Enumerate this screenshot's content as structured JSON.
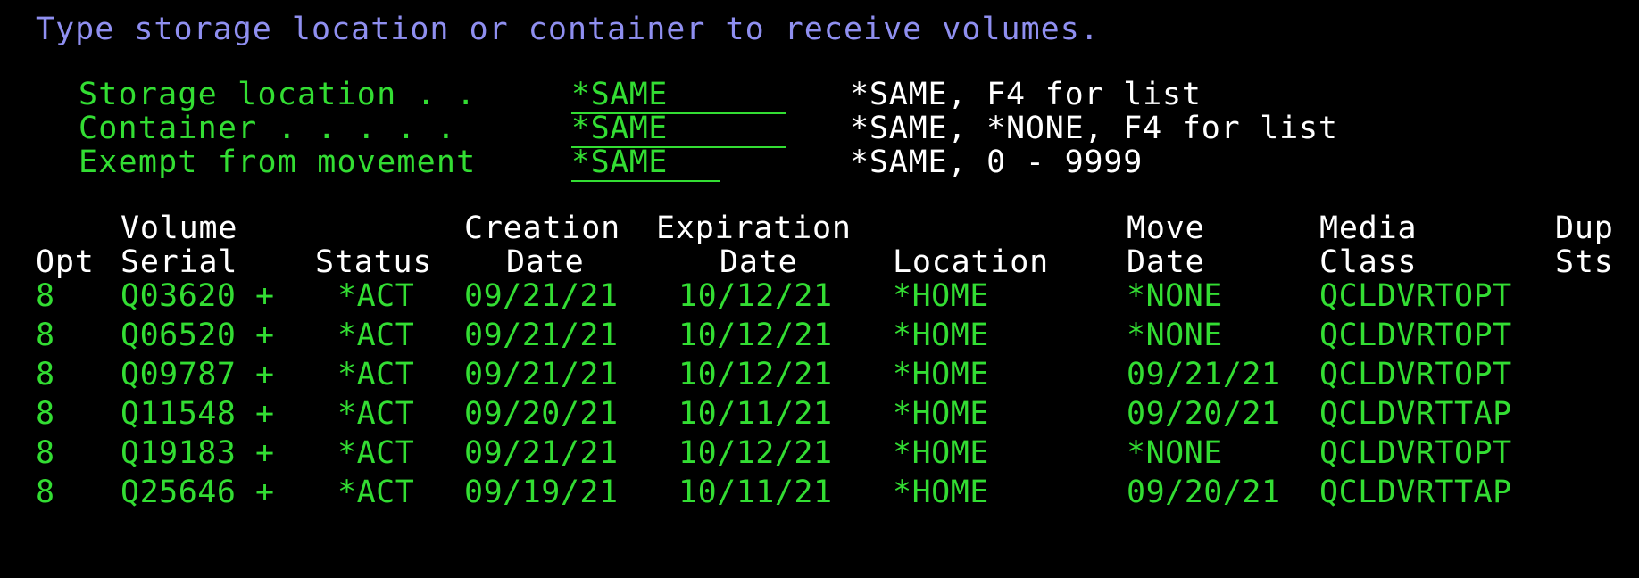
{
  "instruction": "Type storage location or container to receive volumes.",
  "fields": [
    {
      "label": "Storage location . .",
      "value": "*SAME",
      "hint": "*SAME, F4 for list"
    },
    {
      "label": "Container . . . . .",
      "value": "*SAME",
      "hint": "*SAME, *NONE, F4 for list"
    },
    {
      "label": "Exempt from movement",
      "value": "*SAME",
      "hint": "*SAME, 0 - 9999"
    }
  ],
  "table": {
    "header_line1": {
      "volume": "Volume",
      "creation": "Creation",
      "expiration": "Expiration",
      "move": "Move",
      "media": "Media",
      "dup": "Dup"
    },
    "header_line2": {
      "opt": "Opt",
      "serial": "Serial",
      "status": "Status",
      "creation": "Date",
      "expiration": "Date",
      "location": "Location",
      "move": "Date",
      "media": "Class",
      "dup": "Sts"
    },
    "rows": [
      {
        "opt": "8",
        "serial": "Q03620 +",
        "status": "*ACT",
        "creation": "09/21/21",
        "expiration": "10/12/21",
        "location": "*HOME",
        "move": "*NONE",
        "media": "QCLDVRTOPT"
      },
      {
        "opt": "8",
        "serial": "Q06520 +",
        "status": "*ACT",
        "creation": "09/21/21",
        "expiration": "10/12/21",
        "location": "*HOME",
        "move": "*NONE",
        "media": "QCLDVRTOPT"
      },
      {
        "opt": "8",
        "serial": "Q09787 +",
        "status": "*ACT",
        "creation": "09/21/21",
        "expiration": "10/12/21",
        "location": "*HOME",
        "move": "09/21/21",
        "media": "QCLDVRTOPT"
      },
      {
        "opt": "8",
        "serial": "Q11548 +",
        "status": "*ACT",
        "creation": "09/20/21",
        "expiration": "10/11/21",
        "location": "*HOME",
        "move": "09/20/21",
        "media": "QCLDVRTTAP"
      },
      {
        "opt": "8",
        "serial": "Q19183 +",
        "status": "*ACT",
        "creation": "09/21/21",
        "expiration": "10/12/21",
        "location": "*HOME",
        "move": "*NONE",
        "media": "QCLDVRTOPT"
      },
      {
        "opt": "8",
        "serial": "Q25646 +",
        "status": "*ACT",
        "creation": "09/19/21",
        "expiration": "10/11/21",
        "location": "*HOME",
        "move": "09/20/21",
        "media": "QCLDVRTTAP"
      }
    ]
  }
}
